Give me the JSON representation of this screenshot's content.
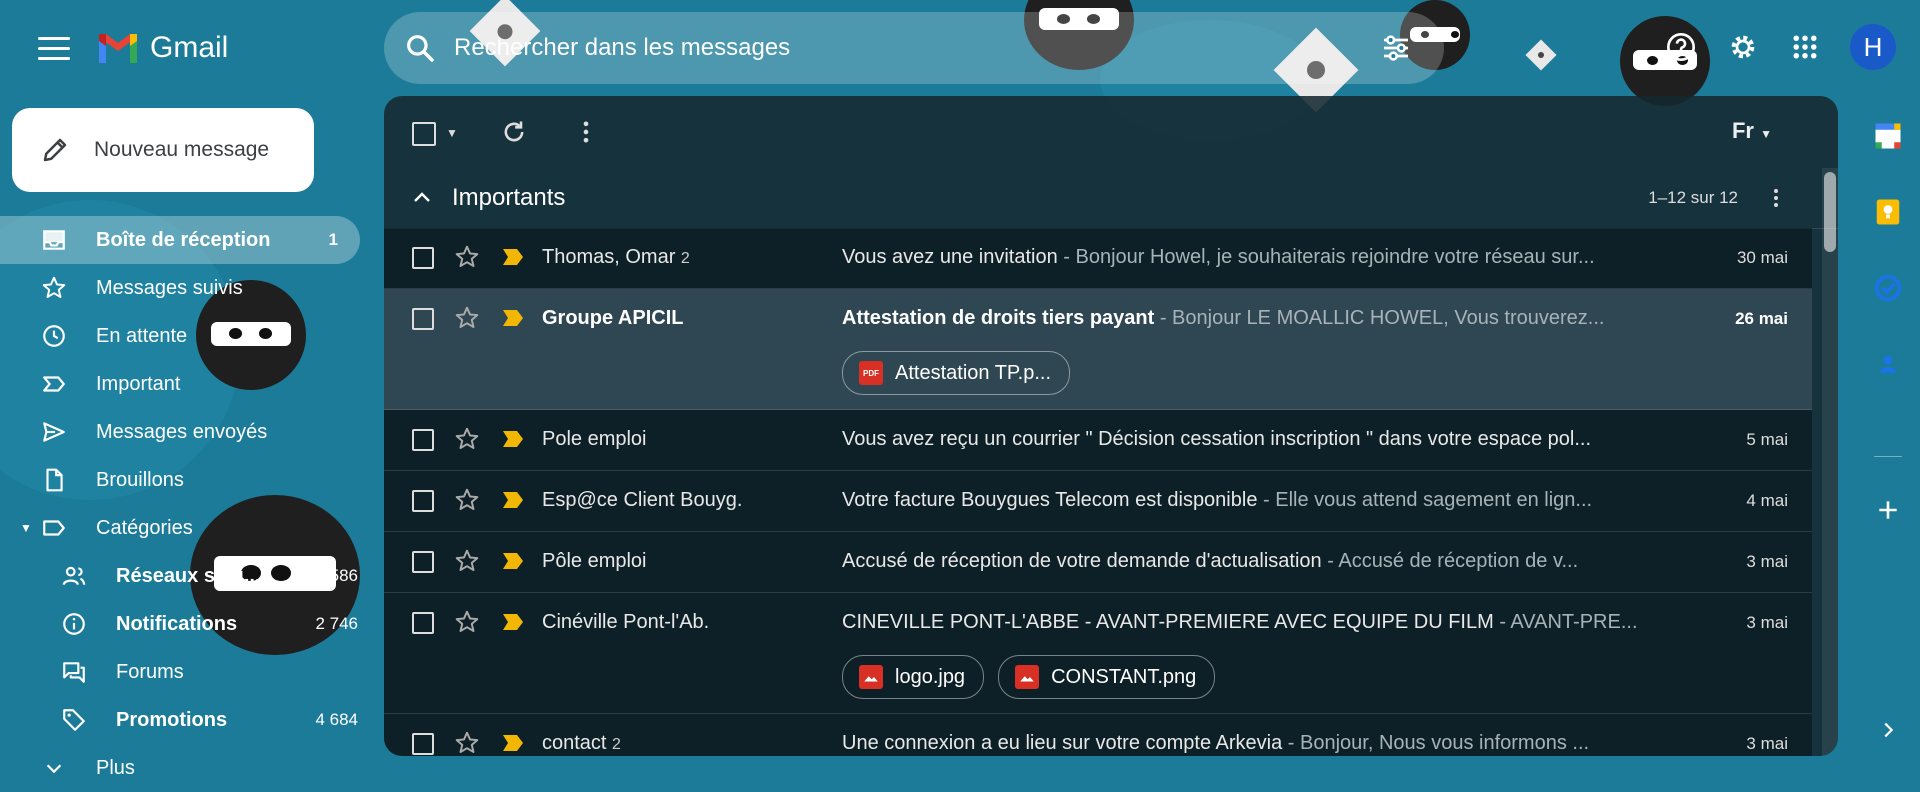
{
  "app": {
    "name": "Gmail"
  },
  "search": {
    "placeholder": "Rechercher dans les messages"
  },
  "account": {
    "initial": "H"
  },
  "compose": {
    "label": "Nouveau message"
  },
  "nav": [
    {
      "label": "Boîte de réception",
      "count": "1",
      "icon": "inbox-icon"
    },
    {
      "label": "Messages suivis",
      "count": "",
      "icon": "star-icon"
    },
    {
      "label": "En attente",
      "count": "",
      "icon": "clock-icon"
    },
    {
      "label": "Important",
      "count": "",
      "icon": "important-icon"
    },
    {
      "label": "Messages envoyés",
      "count": "",
      "icon": "send-icon"
    },
    {
      "label": "Brouillons",
      "count": "",
      "icon": "draft-icon"
    },
    {
      "label": "Catégories",
      "count": "",
      "icon": "label-icon"
    }
  ],
  "categories": [
    {
      "label": "Réseaux soci...",
      "count": "5 586",
      "icon": "people-icon"
    },
    {
      "label": "Notifications",
      "count": "2 746",
      "icon": "info-icon"
    },
    {
      "label": "Forums",
      "count": "",
      "icon": "forum-icon"
    },
    {
      "label": "Promotions",
      "count": "4 684",
      "icon": "tag-icon"
    }
  ],
  "more": {
    "label": "Plus"
  },
  "toolbar": {
    "lang": "Fr"
  },
  "section": {
    "title": "Importants",
    "range": "1–12 sur 12"
  },
  "emails": [
    {
      "sender": "Thomas, Omar",
      "count": "2",
      "subject": "Vous avez une invitation",
      "snippet": " - Bonjour Howel, je souhaiterais rejoindre votre réseau sur...",
      "date": "30 mai"
    },
    {
      "sender": "Groupe APICIL",
      "count": "",
      "subject": "Attestation de droits tiers payant",
      "snippet": " - Bonjour LE MOALLIC HOWEL, Vous trouverez...",
      "date": "26 mai",
      "attachments": [
        "Attestation TP.p..."
      ]
    },
    {
      "sender": "Pole emploi",
      "count": "",
      "subject": "Vous avez reçu un courrier \" Décision cessation inscription \" dans votre espace pol...",
      "snippet": "",
      "date": "5 mai"
    },
    {
      "sender": "Esp@ce Client Bouyg.",
      "count": "",
      "subject": "Votre facture Bouygues Telecom est disponible",
      "snippet": " - Elle vous attend sagement en lign...",
      "date": "4 mai"
    },
    {
      "sender": "Pôle emploi",
      "count": "",
      "subject": "Accusé de réception de votre demande d'actualisation",
      "snippet": " - Accusé de réception de v...",
      "date": "3 mai"
    },
    {
      "sender": "Cinéville Pont-l'Ab.",
      "count": "",
      "subject": "CINEVILLE PONT-L'ABBE - AVANT-PREMIERE AVEC EQUIPE DU FILM",
      "snippet": " - AVANT-PRE...",
      "date": "3 mai",
      "attachments": [
        "logo.jpg",
        "CONSTANT.png"
      ]
    },
    {
      "sender": "contact",
      "count": "2",
      "subject": "Une connexion a eu lieu sur votre compte Arkevia",
      "snippet": " - Bonjour, Nous vous informons ...",
      "date": "3 mai"
    }
  ],
  "attach_icon_text": "PDF",
  "colors": {
    "background": "#1c7b98",
    "panel": "#162830",
    "importance": "#f2b705",
    "avatar": "#1a59c8"
  }
}
